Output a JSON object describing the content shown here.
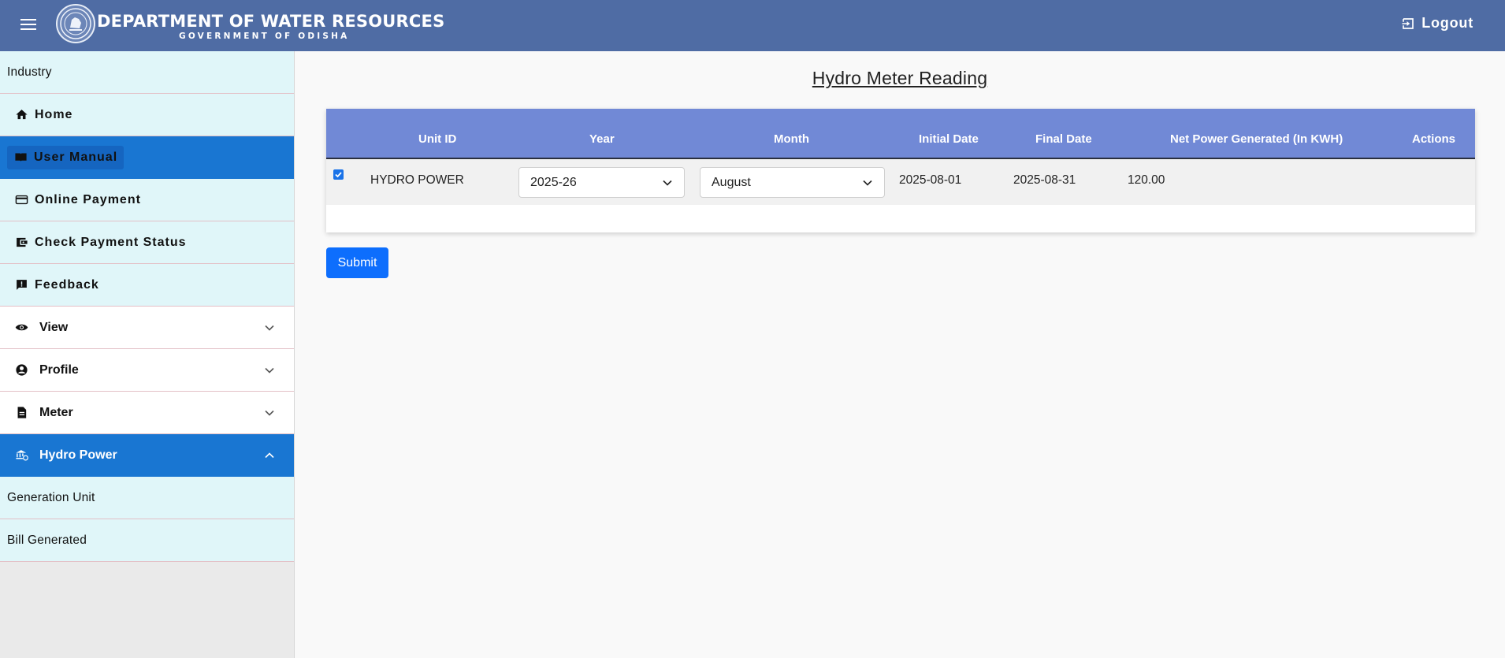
{
  "header": {
    "title": "DEPARTMENT OF WATER RESOURCES",
    "subtitle": "GOVERNMENT OF ODISHA",
    "logout_label": "Logout",
    "brand_color": "#4f6ca4"
  },
  "sidebar": {
    "top_label": "Industry",
    "nav": [
      {
        "label": "Home",
        "icon": "home-icon"
      },
      {
        "label": "User Manual",
        "icon": "book-icon",
        "active": true
      },
      {
        "label": "Online Payment",
        "icon": "credit-card-icon"
      },
      {
        "label": "Check Payment Status",
        "icon": "wallet-icon"
      },
      {
        "label": "Feedback",
        "icon": "feedback-icon"
      }
    ],
    "accordion": [
      {
        "label": "View",
        "icon": "eye-icon",
        "expanded": false
      },
      {
        "label": "Profile",
        "icon": "account-icon",
        "expanded": false
      },
      {
        "label": "Meter",
        "icon": "document-icon",
        "expanded": false
      },
      {
        "label": "Hydro Power",
        "icon": "bank-icon",
        "expanded": true
      }
    ],
    "sub_items": [
      "Generation Unit",
      "Bill Generated"
    ],
    "active_color": "#1976d2"
  },
  "main": {
    "title": "Hydro Meter Reading",
    "table": {
      "headers": [
        "Unit ID",
        "Year",
        "Month",
        "Initial Date",
        "Final Date",
        "Net Power Generated (In KWH)",
        "Actions"
      ],
      "rows": [
        {
          "checked": true,
          "unit_id": "HYDRO POWER",
          "year": "2025-26",
          "month": "August",
          "initial_date": "2025-08-01",
          "final_date": "2025-08-31",
          "net_power": "120.00",
          "actions": ""
        }
      ],
      "header_color": "#7189d6"
    },
    "submit_label": "Submit",
    "submit_color": "#0d6efd"
  }
}
